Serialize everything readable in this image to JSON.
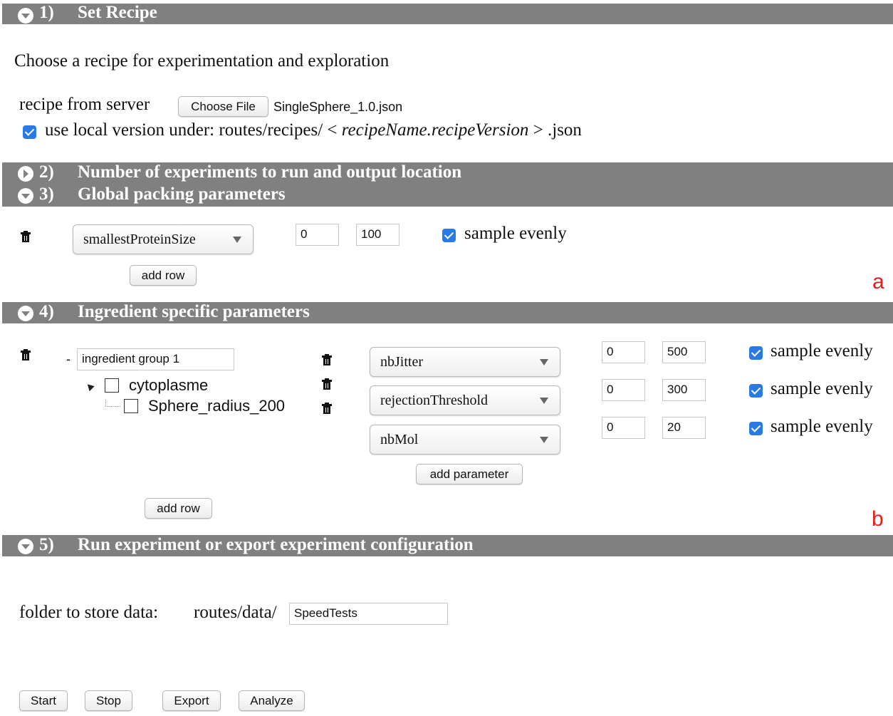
{
  "section1": {
    "number": "1)",
    "title": "Set Recipe",
    "description": "Choose a recipe for experimentation and exploration",
    "recipe_label": "recipe from server",
    "choose_file_label": "Choose File",
    "file_name": "SingleSphere_1.0.json",
    "local_version": {
      "prefix": "use local version under: routes/recipes/ <",
      "italic": "recipeName.recipeVersion",
      "suffix": "> .json"
    }
  },
  "section2": {
    "number": "2)",
    "title": "Number of experiments to run and output location"
  },
  "section3": {
    "number": "3)",
    "title": "Global packing parameters",
    "row": {
      "parameter": "smallestProteinSize",
      "min": "0",
      "max": "100",
      "sample_label": "sample evenly"
    },
    "add_row_label": "add row"
  },
  "section4": {
    "number": "4)",
    "title": "Ingredient specific parameters",
    "group_name": "ingredient group 1",
    "collapse_symbol": "-",
    "tree": [
      {
        "label": "cytoplasme"
      },
      {
        "label": "Sphere_radius_200"
      }
    ],
    "parameters": [
      {
        "name": "nbJitter",
        "min": "0",
        "max": "500",
        "sample_label": "sample evenly"
      },
      {
        "name": "rejectionThreshold",
        "min": "0",
        "max": "300",
        "sample_label": "sample evenly"
      },
      {
        "name": "nbMol",
        "min": "0",
        "max": "20",
        "sample_label": "sample evenly"
      }
    ],
    "add_parameter_label": "add parameter",
    "add_row_label": "add row"
  },
  "section5": {
    "number": "5)",
    "title": "Run experiment or export experiment configuration",
    "folder_label": "folder to store data:",
    "folder_prefix": "routes/data/",
    "folder_value": "SpeedTests",
    "buttons": {
      "start": "Start",
      "stop": "Stop",
      "export": "Export",
      "analyze": "Analyze"
    }
  },
  "annotations": {
    "a": "a",
    "b": "b"
  },
  "colors": {
    "section_bar": "#808080",
    "checkbox": "#2a7ae4",
    "annotation": "#e0201a"
  }
}
